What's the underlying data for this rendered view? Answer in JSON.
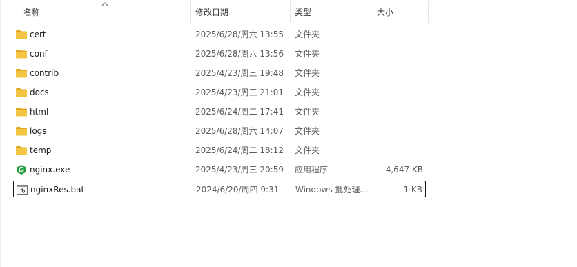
{
  "columns": {
    "name": "名称",
    "modified": "修改日期",
    "type": "类型",
    "size": "大小"
  },
  "files": [
    {
      "name": "cert",
      "modified": "2025/6/28/周六 13:55",
      "type": "文件夹",
      "size": "",
      "icon": "folder-icon"
    },
    {
      "name": "conf",
      "modified": "2025/6/28/周六 13:56",
      "type": "文件夹",
      "size": "",
      "icon": "folder-icon"
    },
    {
      "name": "contrib",
      "modified": "2025/4/23/周三 19:48",
      "type": "文件夹",
      "size": "",
      "icon": "folder-icon"
    },
    {
      "name": "docs",
      "modified": "2025/4/23/周三 21:01",
      "type": "文件夹",
      "size": "",
      "icon": "folder-icon"
    },
    {
      "name": "html",
      "modified": "2025/6/24/周二 17:41",
      "type": "文件夹",
      "size": "",
      "icon": "folder-icon"
    },
    {
      "name": "logs",
      "modified": "2025/6/28/周六 14:07",
      "type": "文件夹",
      "size": "",
      "icon": "folder-icon"
    },
    {
      "name": "temp",
      "modified": "2025/6/24/周二 18:12",
      "type": "文件夹",
      "size": "",
      "icon": "folder-icon"
    },
    {
      "name": "nginx.exe",
      "modified": "2025/4/23/周三 20:59",
      "type": "应用程序",
      "size": "4,647 KB",
      "icon": "nginx-app-icon"
    },
    {
      "name": "nginxRes.bat",
      "modified": "2024/6/20/周四 9:31",
      "type": "Windows 批处理...",
      "size": "1 KB",
      "icon": "batch-file-icon"
    }
  ],
  "selected_index": 8,
  "colors": {
    "folder": "#f4c542",
    "folder_dark": "#e0a91f",
    "nginx_green": "#1f9a3a",
    "selection_border": "#1a1a1a"
  }
}
